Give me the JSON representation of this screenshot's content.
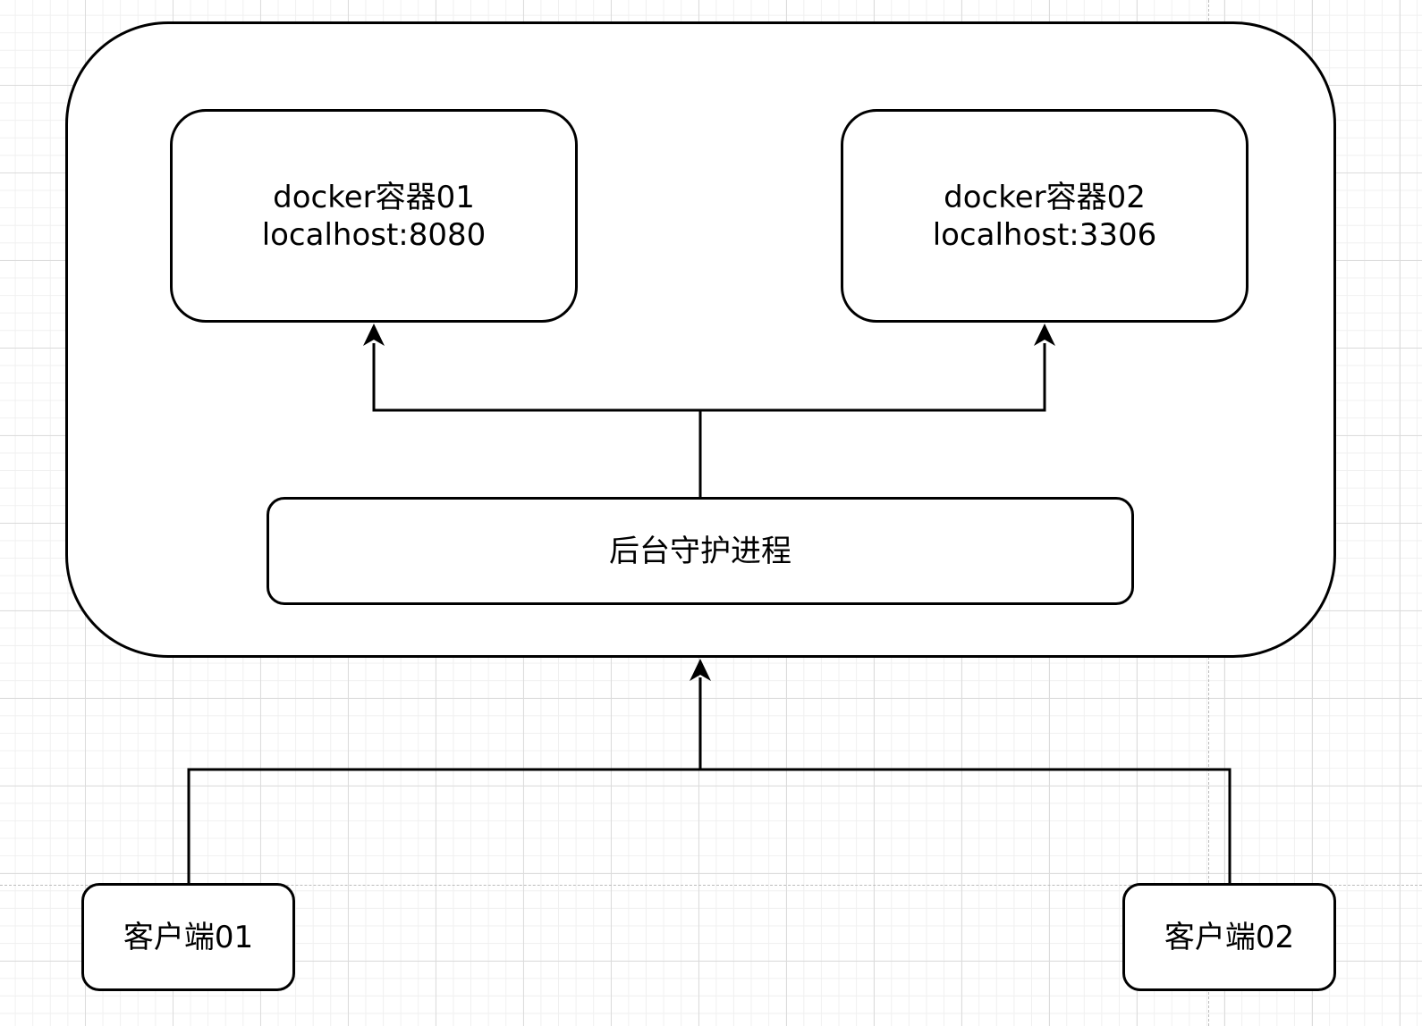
{
  "diagram": {
    "host": {
      "label": ""
    },
    "containers": [
      {
        "name": "docker容器01",
        "address": "localhost:8080"
      },
      {
        "name": "docker容器02",
        "address": "localhost:3306"
      }
    ],
    "daemon": {
      "label": "后台守护进程"
    },
    "clients": [
      {
        "label": "客户端01"
      },
      {
        "label": "客户端02"
      }
    ],
    "edges": [
      {
        "from": "客户端01",
        "to": "后台守护进程"
      },
      {
        "from": "客户端02",
        "to": "后台守护进程"
      },
      {
        "from": "后台守护进程",
        "to": "docker容器01"
      },
      {
        "from": "后台守护进程",
        "to": "docker容器02"
      }
    ]
  }
}
